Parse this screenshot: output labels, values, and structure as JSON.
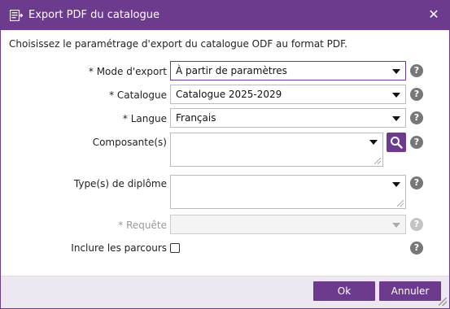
{
  "dialog": {
    "title": "Export PDF du catalogue",
    "close_symbol": "✕",
    "icon": "export-document-icon",
    "accent_color": "#6d3b8e"
  },
  "intro": "Choisissez le paramétrage d'export du catalogue ODF au format PDF.",
  "fields": {
    "mode": {
      "label": "* Mode d'export",
      "value": "À partir de paramètres"
    },
    "catalogue": {
      "label": "* Catalogue",
      "value": "Catalogue 2025-2029"
    },
    "langue": {
      "label": "* Langue",
      "value": "Français"
    },
    "composantes": {
      "label": "Composante(s)",
      "value": ""
    },
    "diplomes": {
      "label": "Type(s) de diplôme",
      "value": ""
    },
    "requete": {
      "label": "* Requête",
      "value": ""
    },
    "parcours": {
      "label": "Inclure les parcours",
      "checked": false
    }
  },
  "help_symbol": "?",
  "buttons": {
    "ok": "Ok",
    "cancel": "Annuler"
  }
}
